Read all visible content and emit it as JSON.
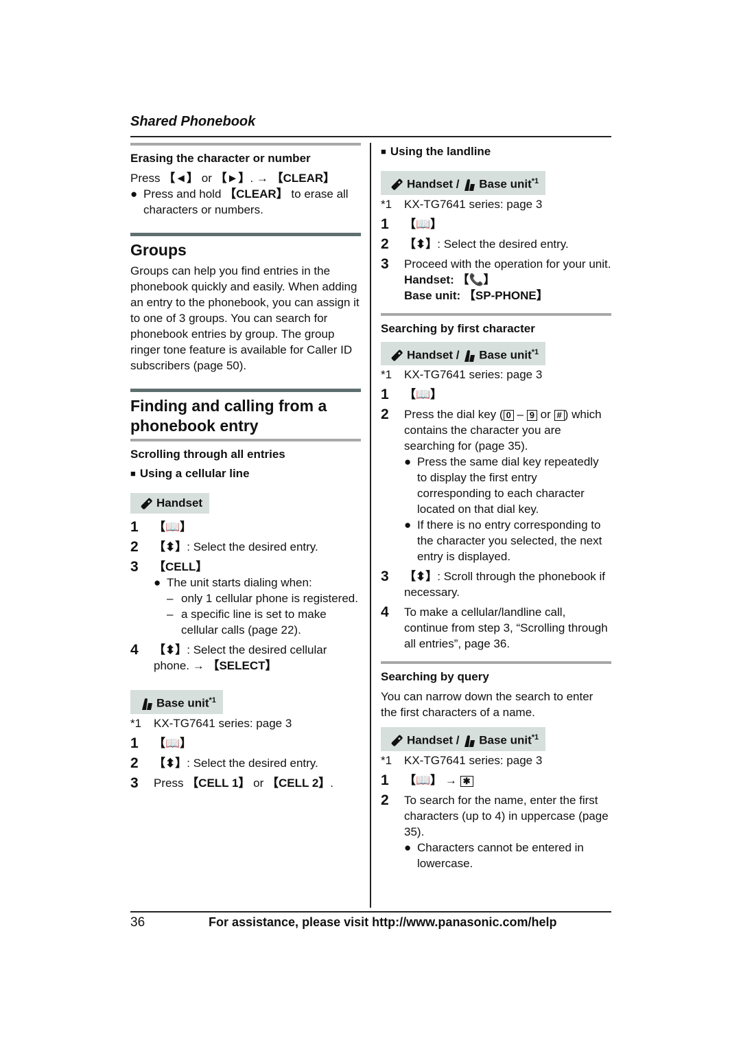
{
  "header": {
    "section_title": "Shared Phonebook"
  },
  "left": {
    "erasing": {
      "heading": "Erasing the character or number",
      "line1_pre": "Press",
      "key_left": "【◄】",
      "or": " or ",
      "key_right": "【►】",
      "arrow": ". → ",
      "key_clear": "【CLEAR】",
      "bullet_pre": "Press and hold ",
      "bullet_key": "【CLEAR】",
      "bullet_post": " to erase all characters or numbers."
    },
    "groups": {
      "heading": "Groups",
      "body": "Groups can help you find entries in the phonebook quickly and easily. When adding an entry to the phonebook, you can assign it to one of 3 groups. You can search for phonebook entries by group. The group ringer tone feature is available for Caller ID subscribers (page 50)."
    },
    "finding": {
      "heading": "Finding and calling from a phonebook entry",
      "scrolling_heading": "Scrolling through all entries",
      "cellular_heading": "Using a cellular line",
      "handset_box": "Handset",
      "steps": [
        {
          "num": "1",
          "key": "【📖】"
        },
        {
          "num": "2",
          "key": "【⬍】",
          "text": ": Select the desired entry."
        },
        {
          "num": "3",
          "key": "【CELL】"
        },
        {
          "num": "4",
          "key": "【⬍】",
          "text": ": Select the desired cellular phone. → ",
          "key2": "【SELECT】"
        }
      ],
      "step3_bullet": "The unit starts dialing when:",
      "step3_dashes": [
        "only 1 cellular phone is registered.",
        "a specific line is set to make cellular calls (page 22)."
      ],
      "base_box": "Base unit",
      "base_sup": "*1",
      "footnote_mark": "*1",
      "footnote_text": "KX-TG7641 series: page 3",
      "base_steps": [
        {
          "num": "1",
          "key": "【📖】"
        },
        {
          "num": "2",
          "key": "【⬍】",
          "text": ": Select the desired entry."
        },
        {
          "num": "3",
          "pre": "Press ",
          "key": "【CELL 1】",
          "mid": " or ",
          "key2": "【CELL 2】",
          "post": "."
        }
      ]
    }
  },
  "right": {
    "landline": {
      "heading": "Using the landline",
      "box_handset": "Handset / ",
      "box_base": "Base unit",
      "box_sup": "*1",
      "footnote_mark": "*1",
      "footnote_text": "KX-TG7641 series: page 3",
      "steps": [
        {
          "num": "1",
          "key": "【📖】"
        },
        {
          "num": "2",
          "key": "【⬍】",
          "text": ": Select the desired entry."
        },
        {
          "num": "3",
          "text": "Proceed with the operation for your unit."
        }
      ],
      "handset_line": "Handset: 【",
      "handset_close": "】",
      "base_line": "Base unit: 【SP-PHONE】"
    },
    "first_char": {
      "heading": "Searching by first character",
      "box_handset": "Handset / ",
      "box_base": "Base unit",
      "box_sup": "*1",
      "footnote_mark": "*1",
      "footnote_text": "KX-TG7641 series: page 3",
      "step1_key": "【📖】",
      "step2_pre": "Press the dial key (",
      "key0": "0",
      "dash": " – ",
      "key9": "9",
      "or": " or ",
      "keyhash": "#",
      "step2_post": ") which contains the character you are searching for (page 35).",
      "bullets": [
        "Press the same dial key repeatedly to display the first entry corresponding to each character located on that dial key.",
        "If there is no entry corresponding to the character you selected, the next entry is displayed."
      ],
      "step3_key": "【⬍】",
      "step3_text": ": Scroll through the phonebook if necessary.",
      "step4_text": "To make a cellular/landline call, continue from step 3, “Scrolling through all entries”, page 36."
    },
    "query": {
      "heading": "Searching by query",
      "body": "You can narrow down the search to enter the first characters of a name.",
      "box_handset": "Handset / ",
      "box_base": "Base unit",
      "box_sup": "*1",
      "footnote_mark": "*1",
      "footnote_text": "KX-TG7641 series: page 3",
      "step1_key": "【📖】",
      "step1_arrow": " → ",
      "step1_star": "✱",
      "step2_text": "To search for the name, enter the first characters (up to 4) in uppercase (page 35).",
      "bullet": "Characters cannot be entered in lowercase."
    }
  },
  "footer": {
    "page_number": "36",
    "help_text": "For assistance, please visit http://www.panasonic.com/help"
  }
}
